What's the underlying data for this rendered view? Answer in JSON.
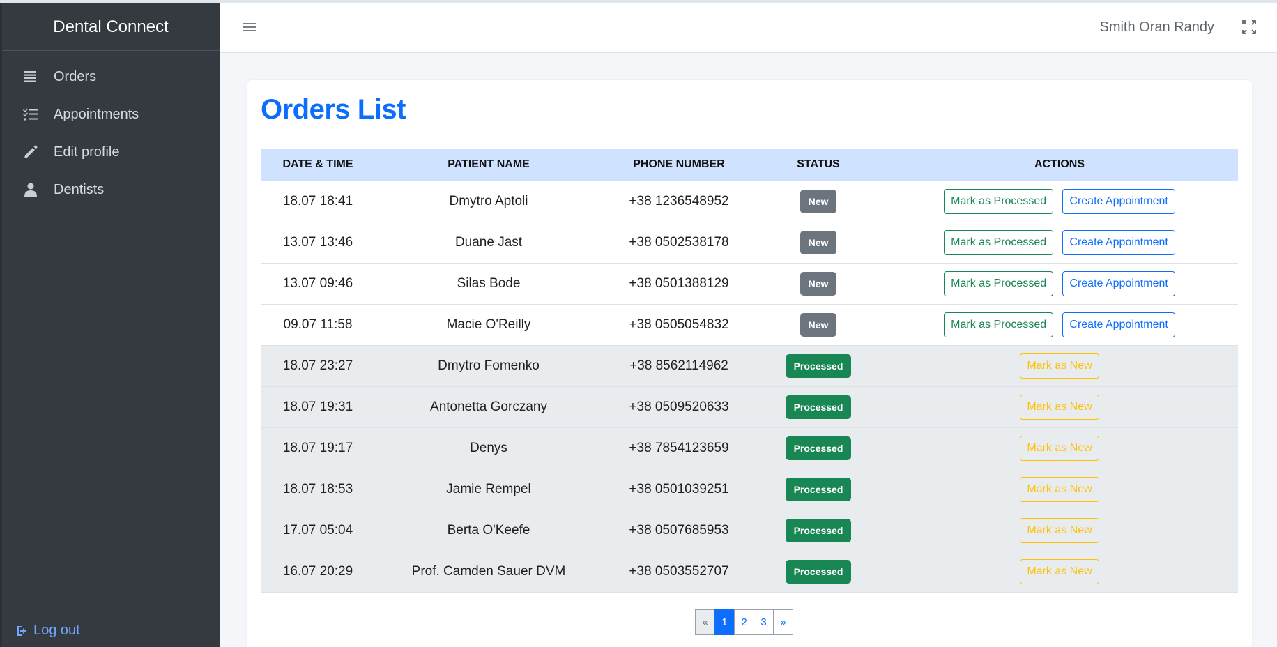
{
  "brand": "Dental Connect",
  "sidebar": {
    "items": [
      {
        "label": "Orders",
        "icon": "list-icon"
      },
      {
        "label": "Appointments",
        "icon": "list-check-icon"
      },
      {
        "label": "Edit profile",
        "icon": "pencil-icon"
      },
      {
        "label": "Dentists",
        "icon": "user-doctor-icon"
      }
    ],
    "logout": "Log out"
  },
  "header": {
    "username": "Smith Oran Randy"
  },
  "page": {
    "title": "Orders List"
  },
  "table": {
    "headers": [
      "DATE & TIME",
      "PATIENT NAME",
      "PHONE NUMBER",
      "STATUS",
      "ACTIONS"
    ],
    "rows": [
      {
        "date": "18.07 18:41",
        "name": "Dmytro Aptoli",
        "phone": "+38 1236548952",
        "status": "New"
      },
      {
        "date": "13.07 13:46",
        "name": "Duane Jast",
        "phone": "+38 0502538178",
        "status": "New"
      },
      {
        "date": "13.07 09:46",
        "name": "Silas Bode",
        "phone": "+38 0501388129",
        "status": "New"
      },
      {
        "date": "09.07 11:58",
        "name": "Macie O'Reilly",
        "phone": "+38 0505054832",
        "status": "New"
      },
      {
        "date": "18.07 23:27",
        "name": "Dmytro Fomenko",
        "phone": "+38 8562114962",
        "status": "Processed"
      },
      {
        "date": "18.07 19:31",
        "name": "Antonetta Gorczany",
        "phone": "+38 0509520633",
        "status": "Processed"
      },
      {
        "date": "18.07 19:17",
        "name": "Denys",
        "phone": "+38 7854123659",
        "status": "Processed"
      },
      {
        "date": "18.07 18:53",
        "name": "Jamie Rempel",
        "phone": "+38 0501039251",
        "status": "Processed"
      },
      {
        "date": "17.07 05:04",
        "name": "Berta O'Keefe",
        "phone": "+38 0507685953",
        "status": "Processed"
      },
      {
        "date": "16.07 20:29",
        "name": "Prof. Camden Sauer DVM",
        "phone": "+38 0503552707",
        "status": "Processed"
      }
    ]
  },
  "actions": {
    "mark_processed": "Mark as Processed",
    "create_appointment": "Create Appointment",
    "mark_new": "Mark as New"
  },
  "pagination": {
    "prev": "«",
    "pages": [
      "1",
      "2",
      "3"
    ],
    "next": "»",
    "current": "1"
  },
  "colors": {
    "accent": "#0d6efd",
    "sidebar_bg": "#343a40",
    "success": "#198754",
    "warning": "#ffc107",
    "secondary": "#6c757d",
    "table_header": "#cfe2ff"
  }
}
